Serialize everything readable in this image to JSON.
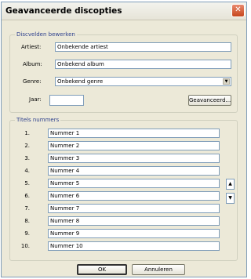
{
  "window": {
    "title": "Geavanceerde discopties"
  },
  "edit_group": {
    "legend": "Discvelden bewerken",
    "artist_label": "Artiest:",
    "artist_value": "Onbekende artiest",
    "album_label": "Album:",
    "album_value": "Onbekend album",
    "genre_label": "Genre:",
    "genre_value": "Onbekend genre",
    "year_label": "Jaar:",
    "year_value": "",
    "advanced_button": "Geavanceerd..."
  },
  "tracks_group": {
    "legend": "Titels nummers",
    "tracks": [
      {
        "num": "1.",
        "title": "Nummer 1"
      },
      {
        "num": "2.",
        "title": "Nummer 2"
      },
      {
        "num": "3.",
        "title": "Nummer 3"
      },
      {
        "num": "4.",
        "title": "Nummer 4"
      },
      {
        "num": "5.",
        "title": "Nummer 5"
      },
      {
        "num": "6.",
        "title": "Nummer 6"
      },
      {
        "num": "7.",
        "title": "Nummer 7"
      },
      {
        "num": "8.",
        "title": "Nummer 8"
      },
      {
        "num": "9.",
        "title": "Nummer 9"
      },
      {
        "num": "10.",
        "title": "Nummer 10"
      }
    ]
  },
  "footer": {
    "ok_label": "OK",
    "cancel_label": "Annuleren"
  }
}
